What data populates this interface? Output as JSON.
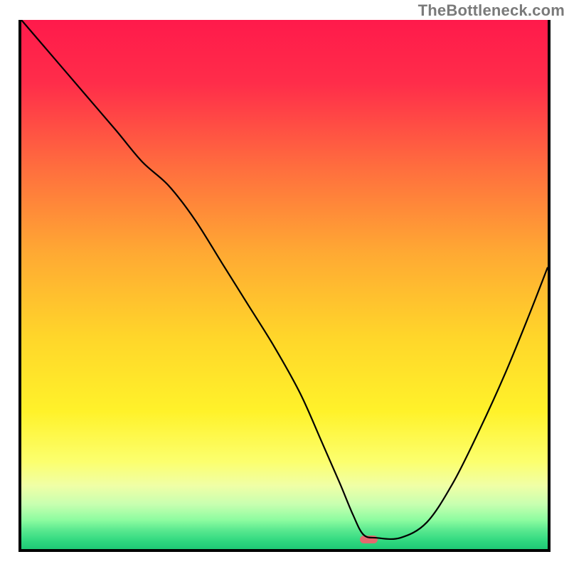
{
  "watermark": "TheBottleneck.com",
  "chart_data": {
    "type": "line",
    "title": "",
    "xlabel": "",
    "ylabel": "",
    "xlim": [
      0,
      100
    ],
    "ylim": [
      0,
      100
    ],
    "grid": false,
    "legend": false,
    "background_gradient": {
      "stops": [
        {
          "pos": 0.0,
          "color": "#ff1a4b"
        },
        {
          "pos": 0.12,
          "color": "#ff2d4a"
        },
        {
          "pos": 0.28,
          "color": "#ff6e3e"
        },
        {
          "pos": 0.44,
          "color": "#ffa933"
        },
        {
          "pos": 0.6,
          "color": "#ffd62a"
        },
        {
          "pos": 0.74,
          "color": "#fff22a"
        },
        {
          "pos": 0.835,
          "color": "#fcff6e"
        },
        {
          "pos": 0.88,
          "color": "#f0ffa6"
        },
        {
          "pos": 0.915,
          "color": "#c8ffb0"
        },
        {
          "pos": 0.945,
          "color": "#8dfca0"
        },
        {
          "pos": 0.965,
          "color": "#58e88f"
        },
        {
          "pos": 0.985,
          "color": "#2fd87f"
        },
        {
          "pos": 1.0,
          "color": "#1fc975"
        }
      ]
    },
    "series": [
      {
        "name": "bottleneck-curve",
        "color": "#000000",
        "x": [
          0,
          6,
          12,
          18,
          23,
          28,
          33,
          38,
          43,
          48,
          53,
          57,
          60.5,
          63,
          65,
          67.5,
          72,
          77,
          82,
          87,
          92,
          96.5,
          100
        ],
        "y": [
          100,
          93,
          86,
          79,
          73,
          68.5,
          62,
          54,
          46,
          38,
          29,
          20,
          12,
          6,
          2.2,
          1.6,
          1.6,
          4.5,
          12,
          22,
          33,
          44,
          53
        ]
      }
    ],
    "marker": {
      "name": "optimal-point",
      "x_center": 66,
      "y_center": 1.8,
      "width_pct": 3.4,
      "height_pct": 1.4,
      "color": "#e5696e"
    }
  }
}
